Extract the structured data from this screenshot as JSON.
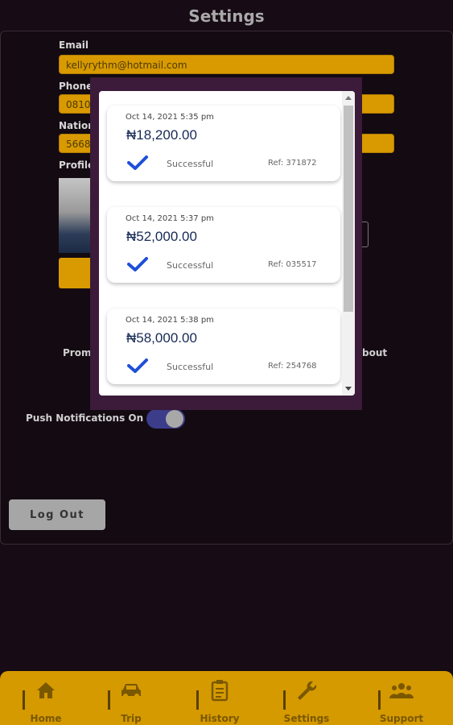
{
  "header": {
    "title": "Settings"
  },
  "form": {
    "email_label": "Email",
    "email_value": "kellyrythm@hotmail.com",
    "phone_label": "Phone",
    "phone_value": "0810",
    "national_label": "Nationa",
    "national_value": "5668",
    "profile_label": "Profile"
  },
  "links": {
    "promo": "Promo",
    "about": "bout"
  },
  "push": {
    "label": "Push Notifications On",
    "on": true
  },
  "logout_label": "Log Out",
  "modal": {
    "transactions": [
      {
        "date": "Oct 14, 2021 5:35 pm",
        "amount": "₦18,200.00",
        "status": "Successful",
        "ref": "Ref: 371872"
      },
      {
        "date": "Oct 14, 2021 5:37 pm",
        "amount": "₦52,000.00",
        "status": "Successful",
        "ref": "Ref: 035517"
      },
      {
        "date": "Oct 14, 2021 5:38 pm",
        "amount": "₦58,000.00",
        "status": "Successful",
        "ref": "Ref: 254768"
      }
    ]
  },
  "nav": {
    "items": [
      {
        "label": "Home",
        "icon": "home-icon"
      },
      {
        "label": "Trip",
        "icon": "car-icon"
      },
      {
        "label": "History",
        "icon": "clipboard-icon"
      },
      {
        "label": "Settings",
        "icon": "wrench-icon"
      },
      {
        "label": "Support",
        "icon": "people-icon"
      }
    ]
  },
  "colors": {
    "background": "#170b15",
    "accent": "#d89a00",
    "modal_frame": "#3b1b39",
    "check": "#1e4fd8",
    "amount": "#172a55"
  }
}
